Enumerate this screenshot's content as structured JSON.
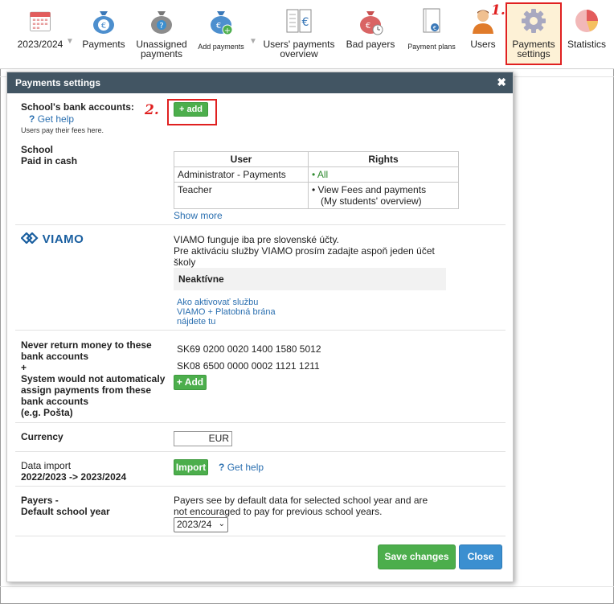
{
  "toolbar": {
    "year": "2023/2024",
    "payments": "Payments",
    "unassigned_1": "Unassigned",
    "unassigned_2": "payments",
    "add_payments": "Add payments",
    "users_overview_1": "Users' payments",
    "users_overview_2": "overview",
    "bad_payers": "Bad payers",
    "payment_plans": "Payment plans",
    "users": "Users",
    "settings_1": "Payments",
    "settings_2": "settings",
    "statistics": "Statistics"
  },
  "steps": {
    "one": "1.",
    "two": "2."
  },
  "dialog": {
    "title": "Payments settings",
    "close_glyph": "✖",
    "bank": {
      "label": "School's bank accounts:",
      "help_icon": "?",
      "help": "Get help",
      "note": "Users pay their fees here.",
      "add": "+ add"
    },
    "cash": {
      "label_1": "School",
      "label_2": "Paid in cash",
      "col_user": "User",
      "col_rights": "Rights",
      "rows": [
        {
          "user": "Administrator - Payments",
          "right_1": "All",
          "right_2": ""
        },
        {
          "user": "Teacher",
          "right_1": "View Fees and payments",
          "right_2": "(My students' overview)"
        }
      ],
      "show_more": "Show more"
    },
    "viamo": {
      "logo": "VIAMO",
      "text_1": "VIAMO funguje iba pre slovenské účty.",
      "text_2": "Pre aktiváciu služby VIAMO prosím zadajte aspoň jeden účet",
      "text_3": "školy",
      "status": "Neaktívne",
      "link_1": "Ako aktivovať službu",
      "link_2": "VIAMO + Platobná brána",
      "link_3": "nájdete tu"
    },
    "never_return": {
      "label_1": "Never return money to these",
      "label_2": "bank accounts",
      "label_3": "+",
      "label_4": "System would not automaticaly",
      "label_5": "assign payments from these",
      "label_6": "bank accounts",
      "label_7": "(e.g. Pošta)",
      "accounts": [
        "SK69 0200 0020 1400 1580 5012",
        "SK08 6500 0000 0002 1121 1211"
      ],
      "add": "+ Add"
    },
    "currency": {
      "label": "Currency",
      "value": "EUR"
    },
    "import": {
      "label_1": "Data import",
      "label_2": "2022/2023 -> 2023/2024",
      "button": "Import",
      "help_icon": "?",
      "help": "Get help"
    },
    "payers": {
      "label_1": "Payers -",
      "label_2": "Default school year",
      "text_1": "Payers see by default data for selected school year and are",
      "text_2": "not encouraged to pay for previous school years.",
      "selected": "2023/24"
    },
    "save": "Save changes",
    "close": "Close"
  },
  "colors": {
    "header": "#425563",
    "green": "#4cae4c",
    "blue": "#3b8fd0",
    "highlight_red": "#e02020",
    "link": "#2a6fb0"
  }
}
